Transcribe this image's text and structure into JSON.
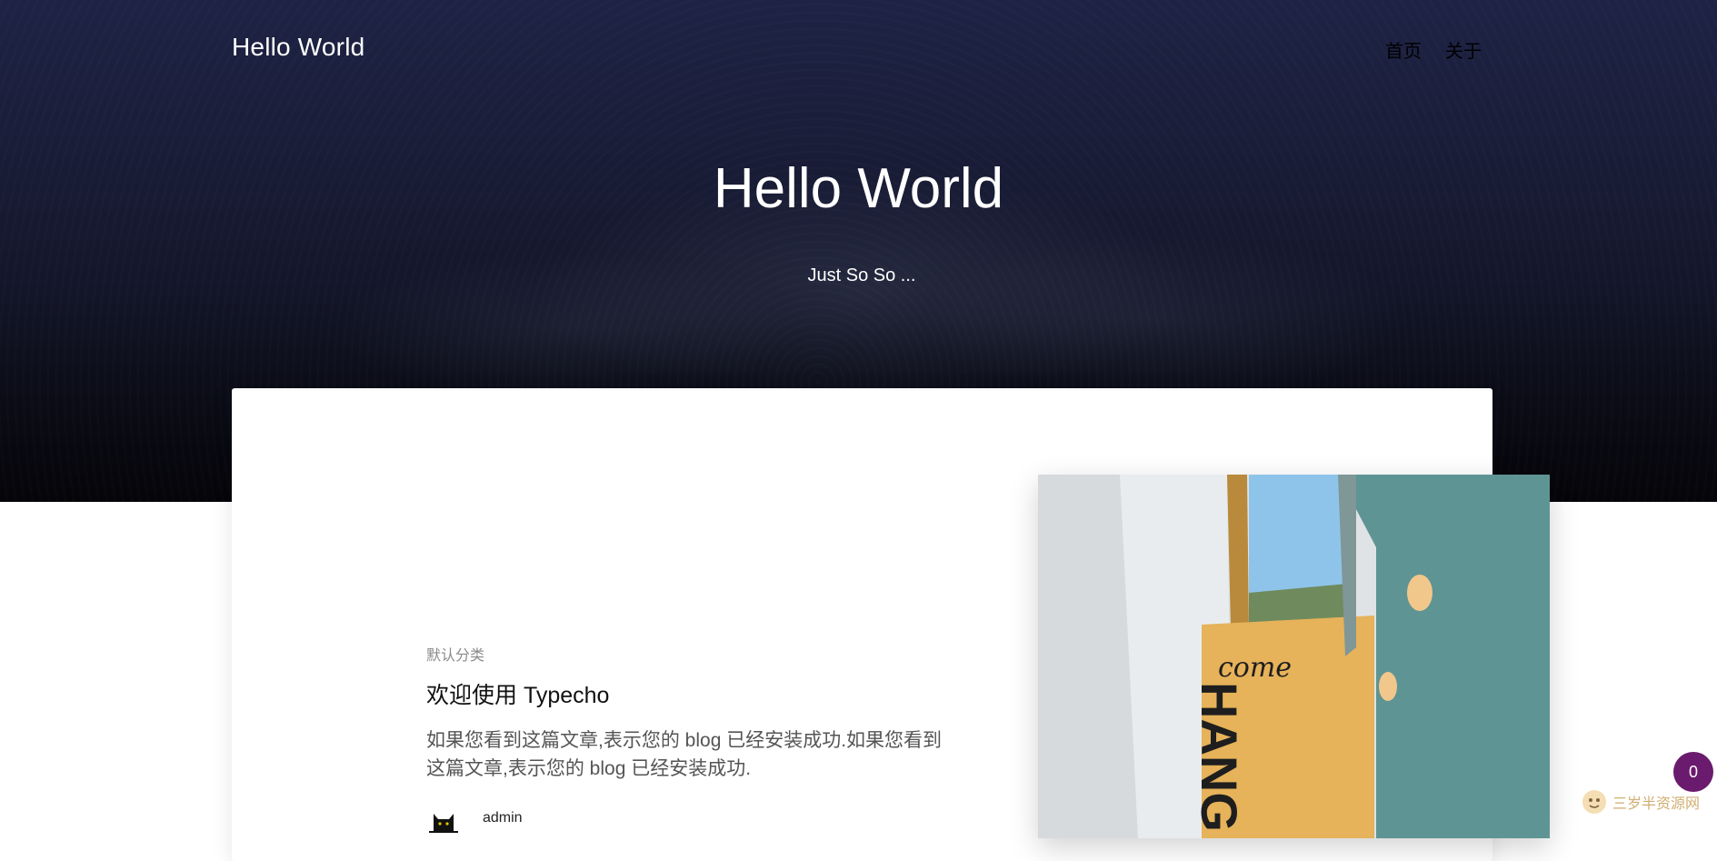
{
  "header": {
    "brand": "Hello World",
    "nav": [
      {
        "label": "首页"
      },
      {
        "label": "关于"
      }
    ]
  },
  "hero": {
    "title": "Hello World",
    "subtitle": "Just So So ..."
  },
  "post": {
    "category": "默认分类",
    "title": "欢迎使用 Typecho",
    "excerpt": "如果您看到这篇文章,表示您的 blog 已经安装成功.如果您看到这篇文章,表示您的 blog 已经安装成功.",
    "author": "admin",
    "thumbnail": {
      "sign_text_top": "come",
      "sign_text_main": "HANG"
    }
  },
  "floating": {
    "count": "0"
  },
  "watermark": {
    "text": "三岁半资源网"
  },
  "colors": {
    "hero_top": "#1e2345",
    "hero_bottom": "#050509",
    "fab": "#6a1b6e"
  }
}
